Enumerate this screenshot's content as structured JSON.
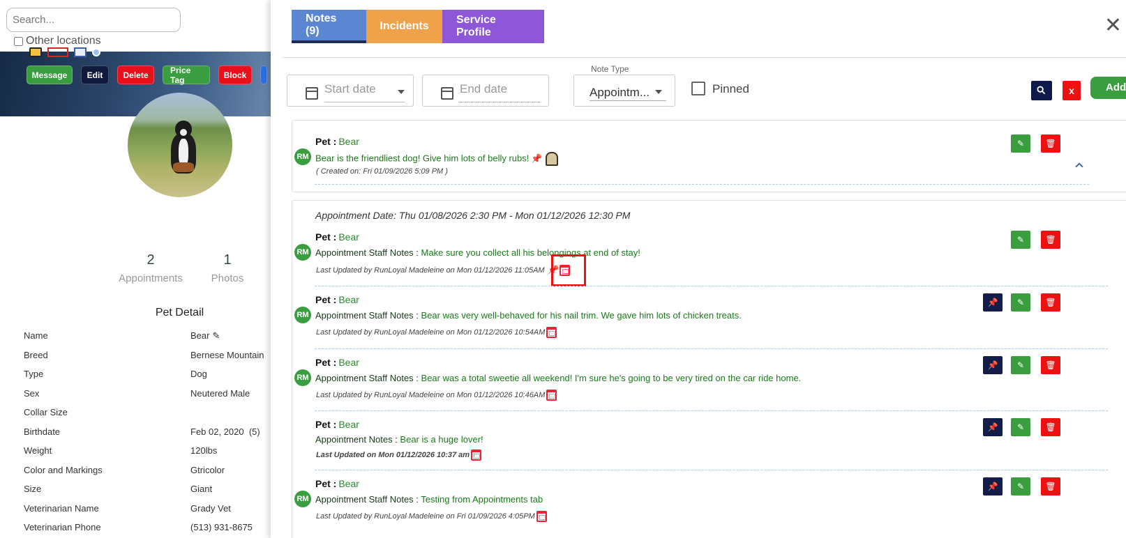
{
  "left": {
    "search_placeholder": "Search...",
    "other_locations": "Other locations",
    "actions": {
      "message": "Message",
      "edit": "Edit",
      "delete": "Delete",
      "price_tag": "Price Tag",
      "block": "Block"
    },
    "stats": {
      "appointments_count": "2",
      "appointments_label": "Appointments",
      "photos_count": "1",
      "photos_label": "Photos"
    },
    "pet_detail_title": "Pet Detail",
    "details": [
      {
        "key": "Name",
        "value": "Bear"
      },
      {
        "key": "Breed",
        "value": "Bernese Mountain"
      },
      {
        "key": "Type",
        "value": "Dog"
      },
      {
        "key": "Sex",
        "value": "Neutered Male"
      },
      {
        "key": "Collar Size",
        "value": ""
      },
      {
        "key": "Birthdate",
        "value": "Feb 02, 2020  (5)"
      },
      {
        "key": "Weight",
        "value": "120lbs"
      },
      {
        "key": "Color and Markings",
        "value": "Gtricolor"
      },
      {
        "key": "Size",
        "value": "Giant"
      },
      {
        "key": "Veterinarian Name",
        "value": "Grady Vet"
      },
      {
        "key": "Veterinarian Phone",
        "value": "(513) 931-8675"
      }
    ]
  },
  "modal": {
    "tabs": {
      "notes": "Notes (9)",
      "incidents": "Incidents",
      "service": "Service Profile"
    },
    "close": "✕",
    "filters": {
      "start_date": "Start date",
      "end_date": "End date",
      "note_type_label": "Note Type",
      "note_type_value": "Appointm...",
      "pinned": "Pinned",
      "clear": "x",
      "add": "Add"
    },
    "pet_label": "Pet :",
    "pet_name": "Bear",
    "avatar_initials": "RM",
    "pinned_note": {
      "text": "Bear is the friendliest dog! Give him lots of belly rubs!",
      "created": "( Created on: Fri 01/09/2026 5:09 PM )"
    },
    "appointment_date": "Appointment Date: Thu 01/08/2026 2:30 PM - Mon 01/12/2026 12:30 PM",
    "notes": [
      {
        "label": "Appointment Staff Notes :",
        "text": "Make sure you collect all his belongings at end of stay!",
        "meta": "Last Updated by RunLoyal Madeleine on Mon 01/12/2026 11:05AM"
      },
      {
        "label": "Appointment Staff Notes :",
        "text": "Bear was very well-behaved for his nail trim. We gave him lots of chicken treats.",
        "meta": "Last Updated by RunLoyal Madeleine on Mon 01/12/2026 10:54AM"
      },
      {
        "label": "Appointment Staff Notes :",
        "text": "Bear was a total sweetie all weekend! I'm sure he's going to be very tired on the car ride home.",
        "meta": "Last Updated by RunLoyal Madeleine on Mon 01/12/2026 10:46AM"
      },
      {
        "label": "Appointment Notes :",
        "text": "Bear is a huge lover!",
        "meta": "Last Updated on Mon 01/12/2026 10:37 am"
      },
      {
        "label": "Appointment Staff Notes :",
        "text": "Testing from Appointments tab",
        "meta": "Last Updated by RunLoyal Madeleine on Fri 01/09/2026 4:05PM"
      }
    ]
  },
  "colors": {
    "green": "#3a9d3f",
    "navy": "#101a3d",
    "red": "#e8101a",
    "tab_notes": "#5b86d1",
    "tab_incidents": "#f0a24a",
    "tab_service": "#8d57d8"
  }
}
